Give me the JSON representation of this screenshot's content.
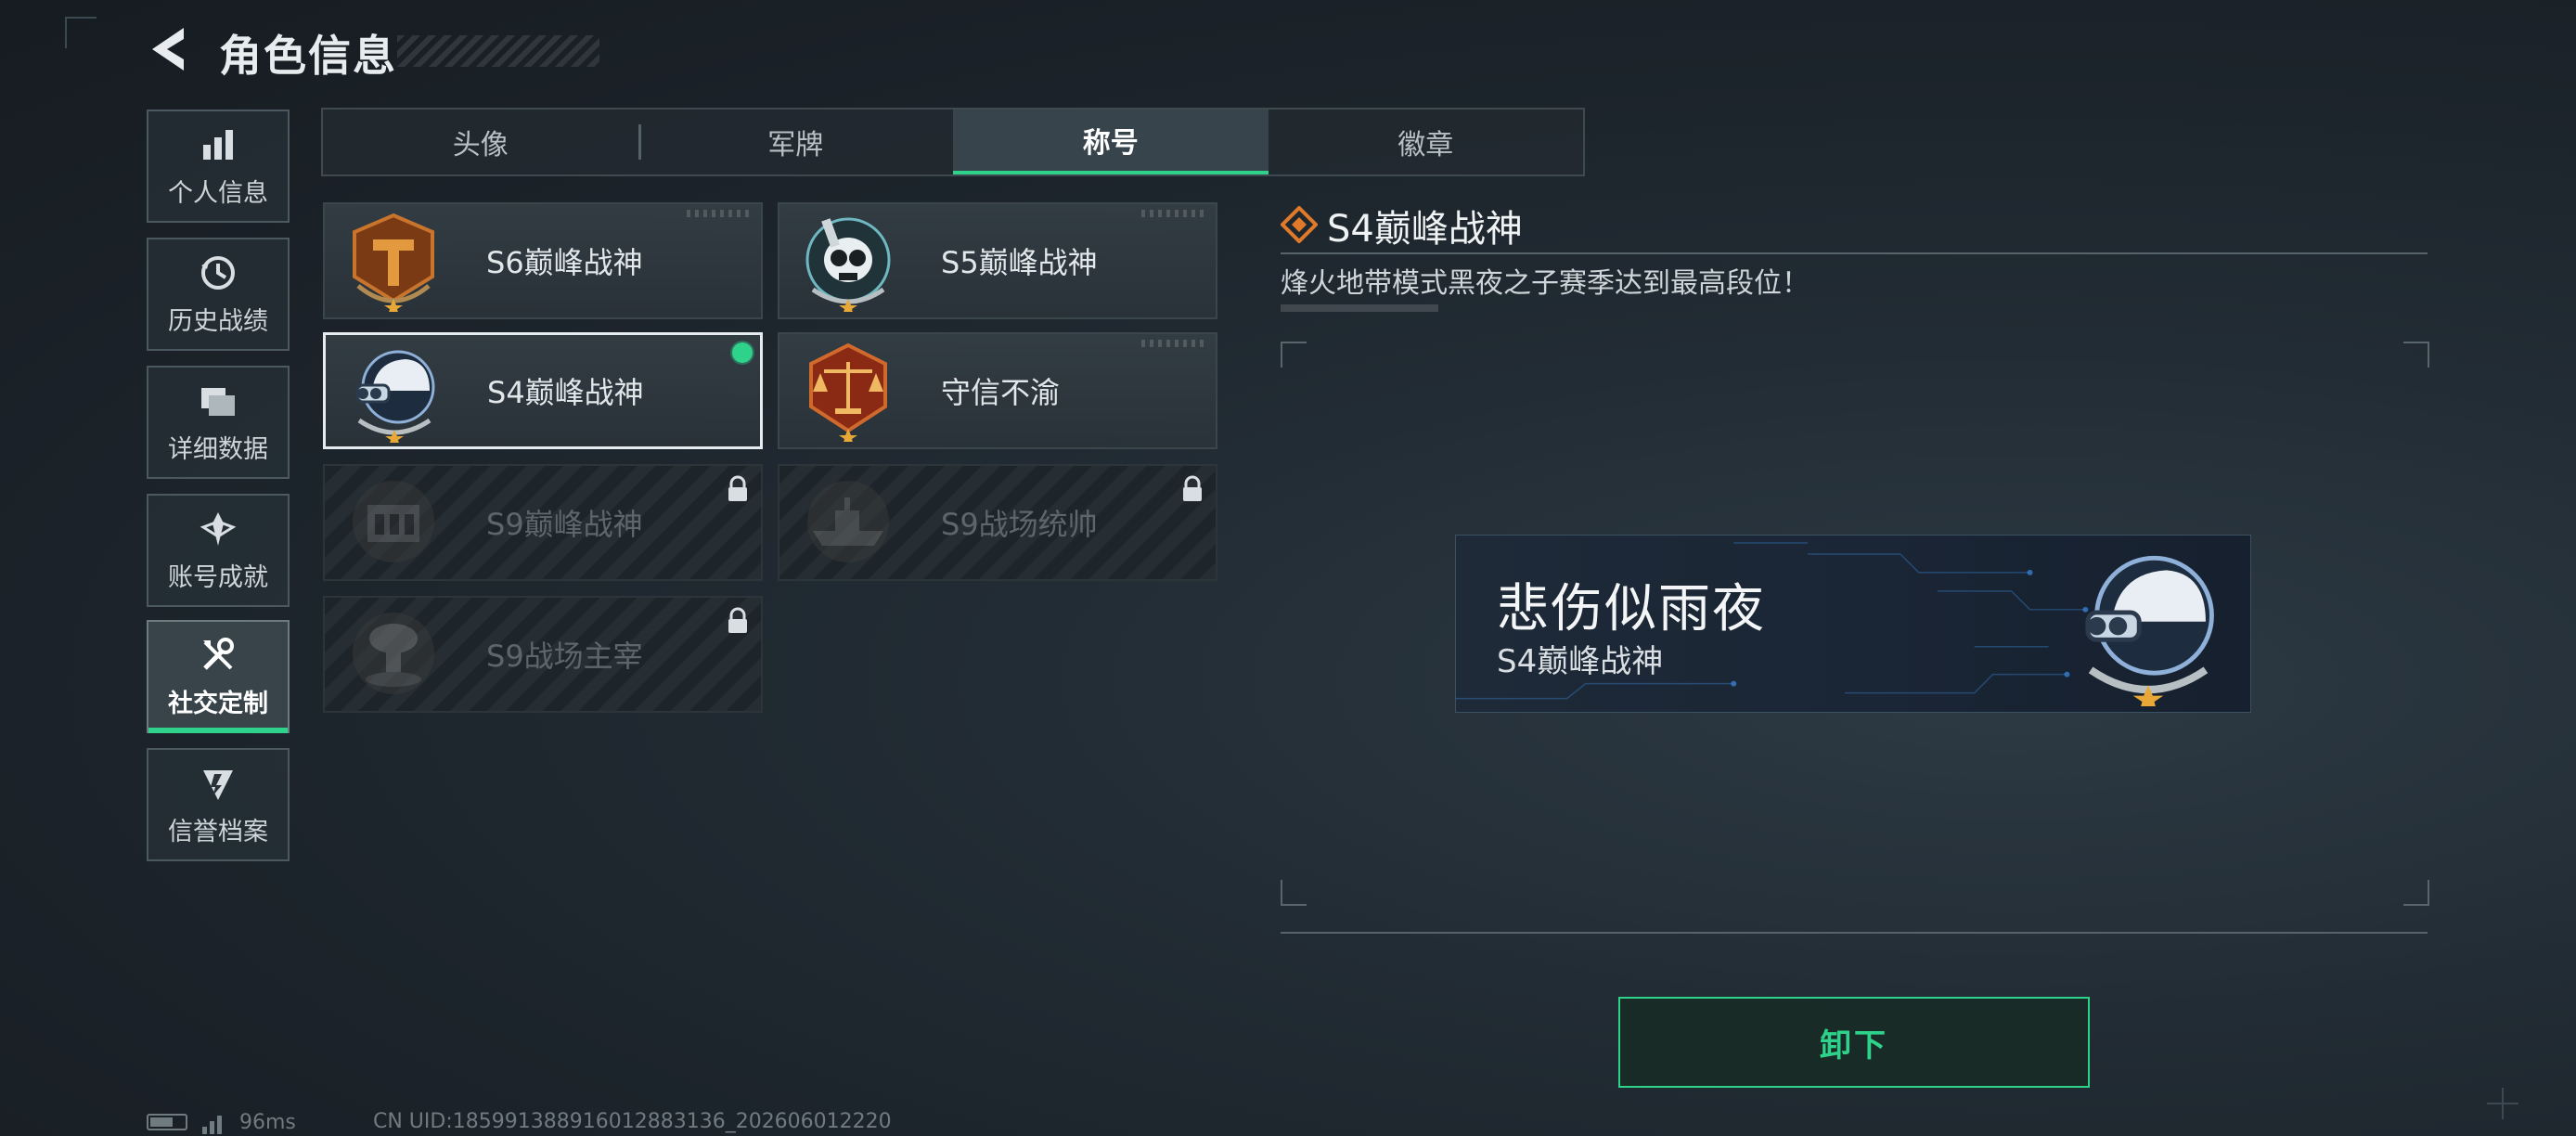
{
  "header": {
    "title": "角色信息"
  },
  "sidebar": {
    "items": [
      {
        "label": "个人信息",
        "icon": "bar-chart-icon",
        "active": false
      },
      {
        "label": "历史战绩",
        "icon": "history-clock-icon",
        "active": false
      },
      {
        "label": "详细数据",
        "icon": "folder-icon",
        "active": false
      },
      {
        "label": "账号成就",
        "icon": "achievement-icon",
        "active": false
      },
      {
        "label": "社交定制",
        "icon": "tools-icon",
        "active": true
      },
      {
        "label": "信誉档案",
        "icon": "credit-shield-icon",
        "active": false
      }
    ]
  },
  "tabs": [
    {
      "label": "头像",
      "active": false
    },
    {
      "label": "军牌",
      "active": false
    },
    {
      "label": "称号",
      "active": true
    },
    {
      "label": "徽章",
      "active": false
    }
  ],
  "titles": [
    {
      "name": "S6巅峰战神",
      "emblem": "bronze-t-emblem-icon",
      "locked": false,
      "selected": false,
      "equipped": false
    },
    {
      "name": "S5巅峰战神",
      "emblem": "skull-emblem-icon",
      "locked": false,
      "selected": false,
      "equipped": false
    },
    {
      "name": "S4巅峰战神",
      "emblem": "night-vision-helmet-emblem-icon",
      "locked": false,
      "selected": true,
      "equipped": true
    },
    {
      "name": "守信不渝",
      "emblem": "scales-emblem-icon",
      "locked": false,
      "selected": false,
      "equipped": false
    },
    {
      "name": "S9巅峰战神",
      "emblem": "bunker-emblem-icon",
      "locked": true,
      "selected": false,
      "equipped": false
    },
    {
      "name": "S9战场统帅",
      "emblem": "warship-emblem-icon",
      "locked": true,
      "selected": false,
      "equipped": false
    },
    {
      "name": "S9战场主宰",
      "emblem": "mushroom-cloud-emblem-icon",
      "locked": true,
      "selected": false,
      "equipped": false
    }
  ],
  "detail": {
    "title": "S4巅峰战神",
    "description": "烽火地带模式黑夜之子赛季达到最高段位！",
    "banner": {
      "player_name": "悲伤似雨夜",
      "title": "S4巅峰战神"
    },
    "action_label": "卸下"
  },
  "status": {
    "ping": "96ms",
    "uid": "CN UID:1859913889160128831​36_202606012220"
  },
  "colors": {
    "accent": "#2ed28a",
    "emblem_orange": "#e07a2a"
  }
}
